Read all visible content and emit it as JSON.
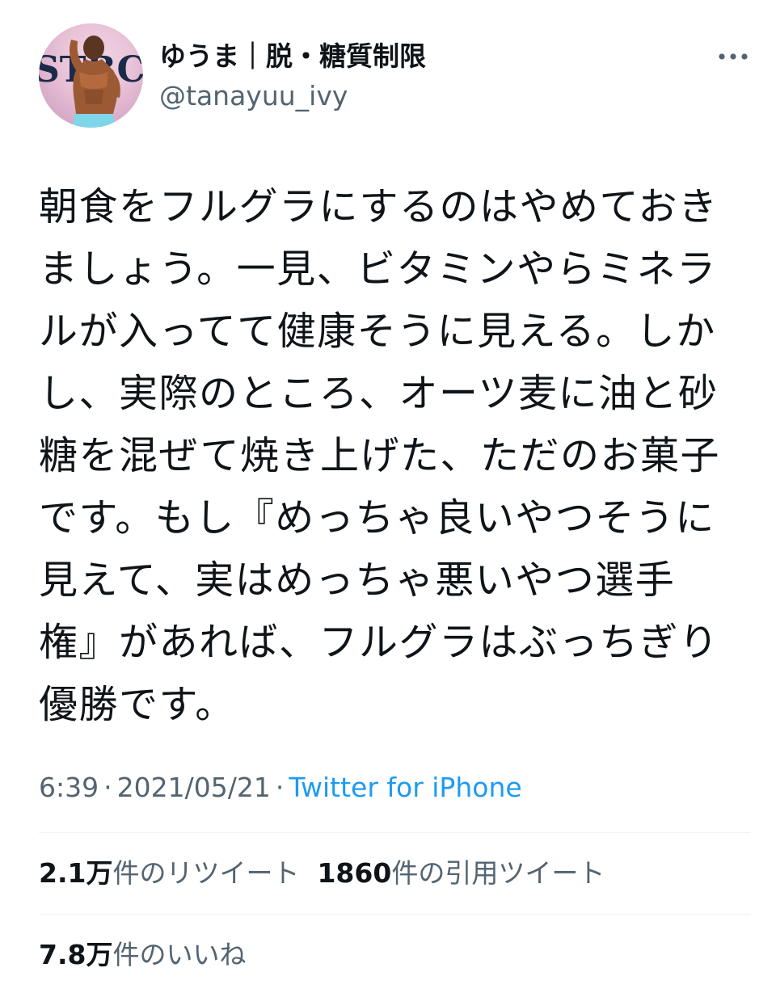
{
  "user": {
    "display_name": "ゆうま｜脱・糖質制限",
    "handle": "@tanayuu_ivy",
    "avatar_text": "STBC"
  },
  "tweet": {
    "text": "朝食をフルグラにするのはやめておき\nましょう。一見、ビタミンやらミネラ\nルが入ってて健康そうに見える。しか\nし、実際のところ、オーツ麦に油と砂\n糖を混ぜて焼き上げた、ただのお菓子\nです。もし『めっちゃ良いやつそうに\n見えて、実はめっちゃ悪いやつ選手\n権』があれば、フルグラはぶっちぎり\n優勝です。",
    "time": "6:39",
    "date": "2021/05/21",
    "separator": "·",
    "source": "Twitter for iPhone"
  },
  "stats": {
    "retweets_count": "2.1万",
    "retweets_label": "件のリツイート",
    "quotes_count": "1860",
    "quotes_label": "件の引用ツイート",
    "likes_count": "7.8万",
    "likes_label": "件のいいね"
  },
  "icons": {
    "more": "more-horizontal-icon"
  },
  "colors": {
    "text": "#0f1419",
    "secondary": "#536471",
    "link": "#1d9bf0",
    "divider": "#eff3f4"
  }
}
